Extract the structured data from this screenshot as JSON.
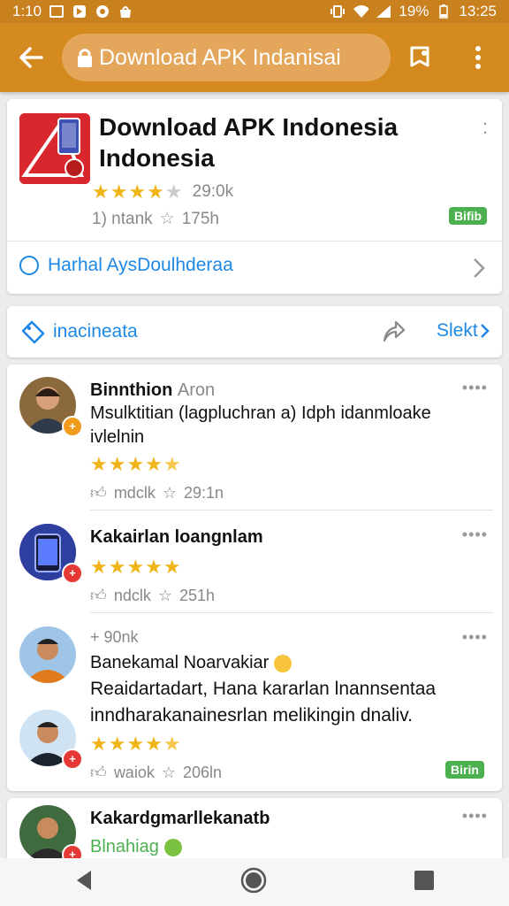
{
  "status_bar": {
    "time": "1:10",
    "battery": "19%",
    "clock": "13:25"
  },
  "toolbar": {
    "url_text": "Download APK Indanisai"
  },
  "app": {
    "title": "Download APK Indonesia Indonesia",
    "rating_value": "29:0k",
    "stars": 3.5,
    "meta_left": "1) ntank",
    "meta_right": "175h",
    "badge": "Bifib",
    "link_label": "Harhal AysDoulhderaa"
  },
  "tag_row": {
    "label": "inacineata",
    "action": "Slekt"
  },
  "reviews": [
    {
      "name": "Binnthion",
      "name_sub": "Aron",
      "text": "Msulktitian (lagpluchran a) Idph idanmloake ivlelnin",
      "stars": 4.5,
      "meta_left": "mdclk",
      "meta_right": "29:1n"
    },
    {
      "name": "Kakairlan loangnlam",
      "stars": 5,
      "meta_left": "ndclk",
      "meta_right": "251h"
    },
    {
      "name_top": "+ 90nk",
      "name": "Banekamal  Noarvakiar",
      "text": "Reaidartadart, Hana kararlan lnannsentaa inndharakanainesrlan melikingin dnaliv.",
      "stars": 4.5,
      "meta_left": "waiok",
      "meta_right": "206ln",
      "badge": "Birin"
    },
    {
      "name": "Kakardgmarllekanatb",
      "sub_green": "Blnahiag"
    }
  ],
  "colors": {
    "accent": "#d58a1f",
    "link": "#1e88e5",
    "star": "#f0b418",
    "badge": "#4caf50"
  }
}
